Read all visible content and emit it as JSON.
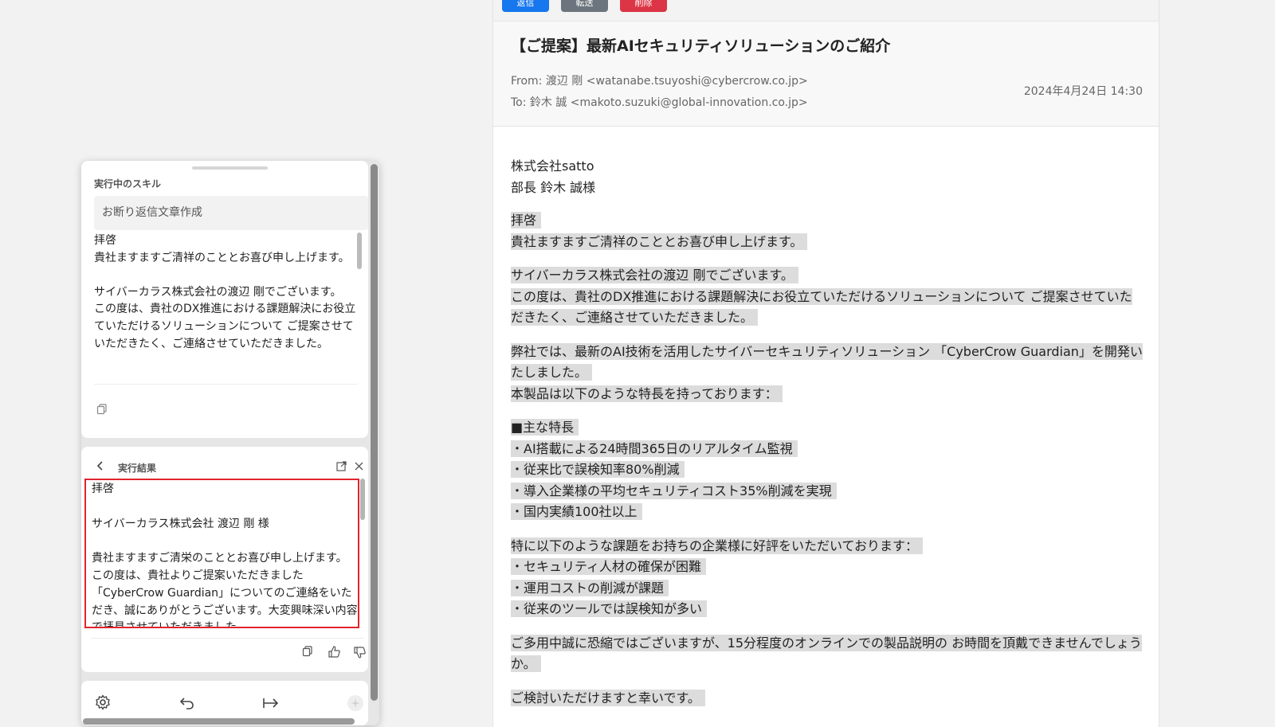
{
  "toolbar": {
    "send_label": "返信",
    "forward_label": "転送",
    "delete_label": "削除"
  },
  "email": {
    "subject": "【ご提案】最新AIセキュリティソリューションのご紹介",
    "from": "From: 渡辺 剛 <watanabe.tsuyoshi@cybercrow.co.jp>",
    "to": "To: 鈴木 誠 <makoto.suzuki@global-innovation.co.jp>",
    "date": "2024年4月24日 14:30",
    "recipient_company": "株式会社satto",
    "recipient_name": "部長 鈴木 誠様",
    "paragraphs": [
      [
        "拝啓",
        "貴社ますますご清祥のこととお喜び申し上げます。"
      ],
      [
        "サイバーカラス株式会社の渡辺 剛でございます。",
        "この度は、貴社のDX推進における課題解決にお役立ていただけるソリューションについて ご提案させていただきたく、ご連絡させていただきました。"
      ],
      [
        "弊社では、最新のAI技術を活用したサイバーセキュリティソリューション 「CyberCrow Guardian」を開発いたしました。",
        "本製品は以下のような特長を持っております："
      ],
      [
        "■主な特長",
        "・AI搭載による24時間365日のリアルタイム監視",
        "・従来比で誤検知率80%削減",
        "・導入企業様の平均セキュリティコスト35%削減を実現",
        "・国内実績100社以上"
      ],
      [
        "特に以下のような課題をお持ちの企業様に好評をいただいております：",
        "・セキュリティ人材の確保が困難",
        "・運用コストの削減が課題",
        "・従来のツールでは誤検知が多い"
      ],
      [
        "ご多用中誠に恐縮ではございますが、15分程度のオンラインでの製品説明の お時間を頂戴できませんでしょうか。"
      ],
      [
        "ご検討いただけますと幸いです。"
      ]
    ]
  },
  "panel": {
    "running_skill_label": "実行中のスキル",
    "skill_name": "お断り返信文章作成",
    "preview_text": "拝啓\n貴社ますますご清祥のこととお喜び申し上げます。\n\nサイバーカラス株式会社の渡辺 剛でございます。\nこの度は、貴社のDX推進における課題解決にお役立ていただけるソリューションについて ご提案させていただきたく、ご連絡させていただきました。",
    "result_label": "実行結果",
    "result_text": "拝啓\n\nサイバーカラス株式会社 渡辺 剛 様\n\n貴社ますますご清栄のこととお喜び申し上げます。\nこの度は、貴社よりご提案いただきました「CyberCrow Guardian」についてのご連絡をいただき、誠にありがとうございます。大変興味深い内容で拝見させていただきました。"
  },
  "icons": {
    "copy": "copy-icon",
    "back": "chevron-left-icon",
    "open_external": "external-link-icon",
    "close": "close-icon",
    "thumbs_up": "thumbs-up-icon",
    "thumbs_down": "thumbs-down-icon",
    "settings": "gear-icon",
    "undo": "undo-icon",
    "insert": "arrow-right-bar-icon",
    "sparkle": "sparkle-icon"
  }
}
